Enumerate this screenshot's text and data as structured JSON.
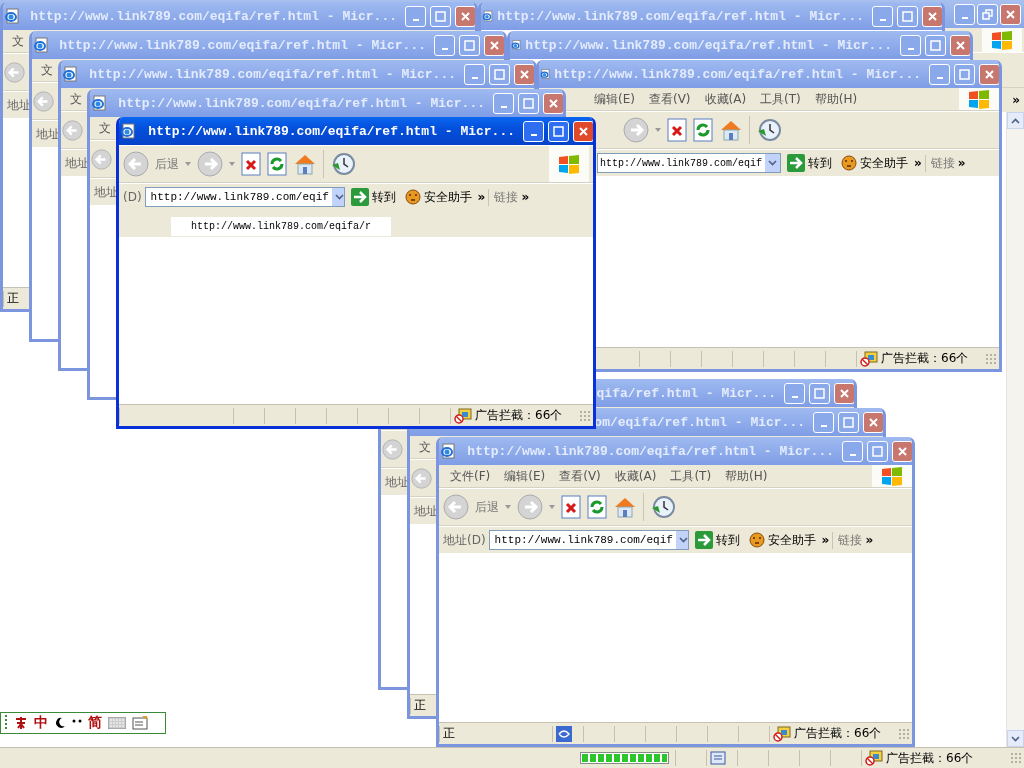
{
  "background_window": {
    "address_more": "»",
    "status": {
      "progress": {
        "level": 1
      },
      "adblock": "广告拦截：66个"
    }
  },
  "windows": [
    {
      "title": {
        "kind": "whole",
        "text": "http://www.link789.com/eqifa/ref.html - Micr..."
      },
      "active": false,
      "menu": {
        "kind": "head",
        "items": [
          "文"
        ]
      },
      "toolbar": {
        "kind": "stub"
      },
      "address": {
        "kind": "label",
        "label": "地址"
      },
      "status": {
        "kind": "text",
        "text": "正"
      }
    },
    {
      "title": {
        "kind": "whole",
        "text": "http://www.link789.com/eqifa/ref.html - Micr..."
      },
      "active": false
    },
    {
      "title": {
        "kind": "whole",
        "text": "http://www.link789.com/eqifa/ref.html - Micr..."
      },
      "active": false,
      "menu": {
        "kind": "head",
        "items": [
          "文"
        ]
      },
      "toolbar": {
        "kind": "stub"
      },
      "address": {
        "kind": "label",
        "label": "地址"
      }
    },
    {
      "title": {
        "kind": "whole",
        "text": "http://www.link789.com/eqifa/ref.html - Micr..."
      },
      "active": false
    },
    {
      "title": {
        "kind": "whole",
        "text": "http://www.link789.com/eqifa/ref.html - Micr..."
      },
      "active": false,
      "menu": {
        "kind": "head",
        "items": [
          "文"
        ]
      },
      "toolbar": {
        "kind": "stub"
      },
      "address": {
        "kind": "label",
        "label": "地址"
      }
    },
    {
      "title": {
        "kind": "whole",
        "text": "http://www.link789.com/eqifa/ref.html - Micr..."
      },
      "active": false,
      "menu": {
        "kind": "tail",
        "items": [
          "编辑(E)",
          "查看(V)",
          "收藏(A)",
          "工具(T)",
          "帮助(H)"
        ]
      },
      "toolbar": {
        "kind": "tail"
      },
      "address": {
        "kind": "tail",
        "url": "http://www.link789.com/eqif",
        "go": "转到",
        "assistant": "安全助手",
        "assistant_more": "»",
        "links": "链接",
        "links_more": "»"
      },
      "status": {
        "kind": "full",
        "secure": false,
        "adblock": "广告拦截：66个"
      }
    },
    {
      "title": {
        "kind": "whole",
        "text": "http://www.link789.com/eqifa/ref.html - Micr..."
      },
      "active": false,
      "menu": {
        "kind": "head",
        "items": [
          "文"
        ]
      },
      "toolbar": {
        "kind": "stub"
      },
      "address": {
        "kind": "label",
        "label": "地址"
      }
    },
    {
      "title": {
        "kind": "whole",
        "text": "http://www.link789.com/eqifa/ref.html - Micr..."
      },
      "active": true,
      "toolbar": {
        "kind": "full",
        "back": "后退"
      },
      "address": {
        "kind": "full",
        "label": "(D)",
        "url": "http://www.link789.com/eqif",
        "go": "转到",
        "assistant": "安全助手",
        "assistant_more": "»",
        "links": "链接",
        "links_more": "»"
      },
      "page_bar": {
        "text": "http://www.link789.com/eqifa/r"
      },
      "status": {
        "kind": "full",
        "secure": false,
        "adblock": "广告拦截：66个"
      }
    },
    {
      "title": {
        "kind": "tail",
        "text": "qifa/ref.html - Micr..."
      },
      "active": false,
      "menu": {
        "kind": "blank"
      },
      "toolbar": {
        "kind": "stub"
      },
      "address": {
        "kind": "label",
        "label": "地址"
      }
    },
    {
      "title": {
        "kind": "tail",
        "text": "om/eqifa/ref.html - Micr..."
      },
      "active": false,
      "menu": {
        "kind": "head",
        "items": [
          "文"
        ]
      },
      "toolbar": {
        "kind": "stub"
      },
      "address": {
        "kind": "label",
        "label": "地址"
      },
      "status": {
        "kind": "text",
        "text": "正"
      }
    },
    {
      "title": {
        "kind": "whole",
        "text": "http://www.link789.com/eqifa/ref.html - Micr..."
      },
      "active": false,
      "menu": {
        "kind": "full",
        "items": [
          "文件(F)",
          "编辑(E)",
          "查看(V)",
          "收藏(A)",
          "工具(T)",
          "帮助(H)"
        ]
      },
      "toolbar": {
        "kind": "full",
        "back": "后退"
      },
      "address": {
        "kind": "full",
        "label": "地址(D)",
        "url": "http://www.link789.com/eqif",
        "go": "转到",
        "assistant": "安全助手",
        "assistant_more": "»",
        "links": "链接",
        "links_more": "»"
      },
      "status": {
        "kind": "full",
        "text": "正",
        "secure": true,
        "adblock": "广告拦截：66个"
      }
    }
  ],
  "ime_bar": {
    "mode": "中",
    "script": "简"
  }
}
